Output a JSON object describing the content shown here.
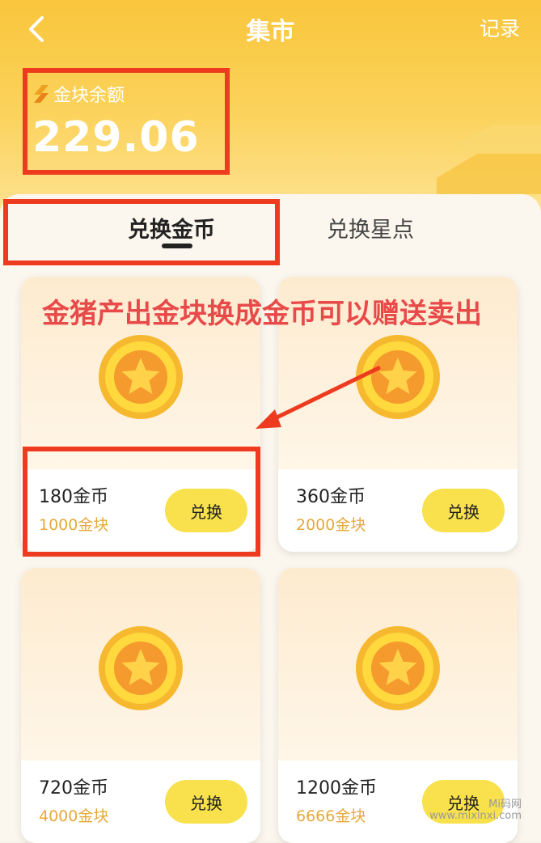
{
  "header": {
    "title": "集市",
    "records_label": "记录",
    "balance_label": "金块余额",
    "balance_value": "229.06",
    "back_icon": "chevron-left-icon"
  },
  "tabs": [
    {
      "label": "兑换金币",
      "active": true
    },
    {
      "label": "兑换星点",
      "active": false
    }
  ],
  "annotation": "金猪产出金块换成金币可以赠送卖出",
  "cards": [
    {
      "name": "180金币",
      "price": "1000金块",
      "button": "兑换"
    },
    {
      "name": "360金币",
      "price": "2000金块",
      "button": "兑换"
    },
    {
      "name": "720金币",
      "price": "4000金块",
      "button": "兑换"
    },
    {
      "name": "1200金币",
      "price": "6666金块",
      "button": "兑换"
    }
  ],
  "watermark": {
    "line1": "Mi码网",
    "line2": "www.mixinxi.com"
  },
  "colors": {
    "header": "#f9c63c",
    "button": "#f8e14c",
    "price": "#e6a93a",
    "annotation": "#e84a4a",
    "highlight": "#ee3a1f"
  }
}
